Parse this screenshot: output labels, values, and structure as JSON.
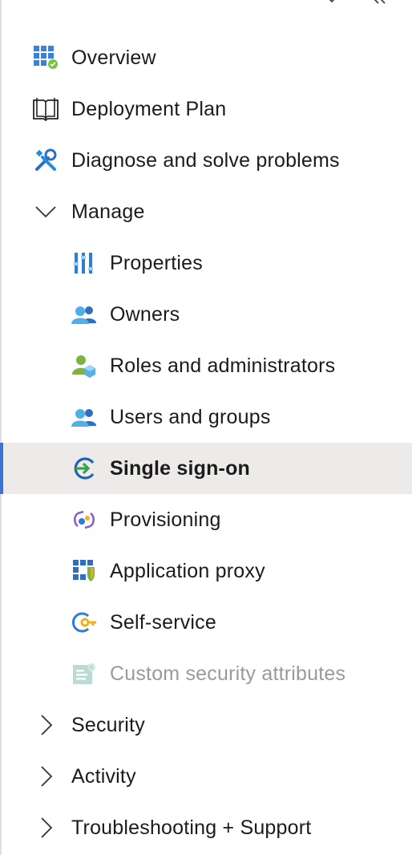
{
  "nav": {
    "items": [
      {
        "label": "Overview",
        "icon": "overview-grid-icon"
      },
      {
        "label": "Deployment Plan",
        "icon": "book-icon"
      },
      {
        "label": "Diagnose and solve problems",
        "icon": "wrench-icon"
      },
      {
        "label": "Manage",
        "icon": "chevron-down-icon"
      },
      {
        "label": "Properties",
        "icon": "properties-icon"
      },
      {
        "label": "Owners",
        "icon": "users-icon"
      },
      {
        "label": "Roles and administrators",
        "icon": "roles-icon"
      },
      {
        "label": "Users and groups",
        "icon": "users-icon"
      },
      {
        "label": "Single sign-on",
        "icon": "single-sign-on-icon"
      },
      {
        "label": "Provisioning",
        "icon": "provisioning-icon"
      },
      {
        "label": "Application proxy",
        "icon": "application-proxy-icon"
      },
      {
        "label": "Self-service",
        "icon": "self-service-key-icon"
      },
      {
        "label": "Custom security attributes",
        "icon": "custom-security-attributes-icon"
      },
      {
        "label": "Security",
        "icon": "chevron-right-icon"
      },
      {
        "label": "Activity",
        "icon": "chevron-right-icon"
      },
      {
        "label": "Troubleshooting + Support",
        "icon": "chevron-right-icon"
      }
    ],
    "selected": "Single sign-on"
  },
  "colors": {
    "accent": "#3a74d8",
    "selected_bg": "#edebe9",
    "disabled_text": "#9a9a9a"
  }
}
